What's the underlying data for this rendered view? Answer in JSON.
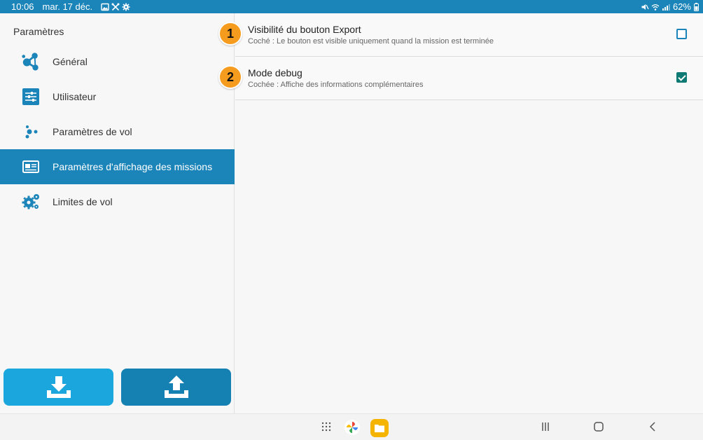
{
  "status_bar": {
    "time": "10:06",
    "date": "mar. 17 déc.",
    "battery": "62%",
    "icons": [
      "image-icon",
      "tools-icon",
      "gear-icon",
      "mute-icon",
      "wifi-icon",
      "signal-icon",
      "battery-icon"
    ]
  },
  "sidebar": {
    "title": "Paramètres",
    "items": [
      {
        "label": "Général",
        "icon": "share-nodes-icon"
      },
      {
        "label": "Utilisateur",
        "icon": "sliders-icon"
      },
      {
        "label": "Paramètres de vol",
        "icon": "dots-icon"
      },
      {
        "label": "Paramètres d'affichage des missions",
        "icon": "card-icon",
        "active": true
      },
      {
        "label": "Limites de vol",
        "icon": "gears-icon"
      }
    ],
    "buttons": [
      {
        "name": "download",
        "icon": "download-icon"
      },
      {
        "name": "upload",
        "icon": "upload-icon"
      }
    ]
  },
  "settings": [
    {
      "badge": "1",
      "title": "Visibilité du bouton Export",
      "description": "Coché : Le bouton est visible uniquement quand la mission est terminée",
      "checked": false
    },
    {
      "badge": "2",
      "title": "Mode debug",
      "description": "Cochée : Affiche des informations complémentaires",
      "checked": true
    }
  ],
  "colors": {
    "primary": "#1b84b9",
    "active_item": "#1b84b9",
    "download_button": "#1ba7dd",
    "upload_button": "#1580b2",
    "badge": "#f59b1e",
    "checkbox_checked": "#0f7a73"
  },
  "nav_bar": {
    "icons": [
      "apps-grid-icon",
      "photos-icon",
      "files-icon",
      "recents-icon",
      "home-icon",
      "back-icon"
    ]
  }
}
